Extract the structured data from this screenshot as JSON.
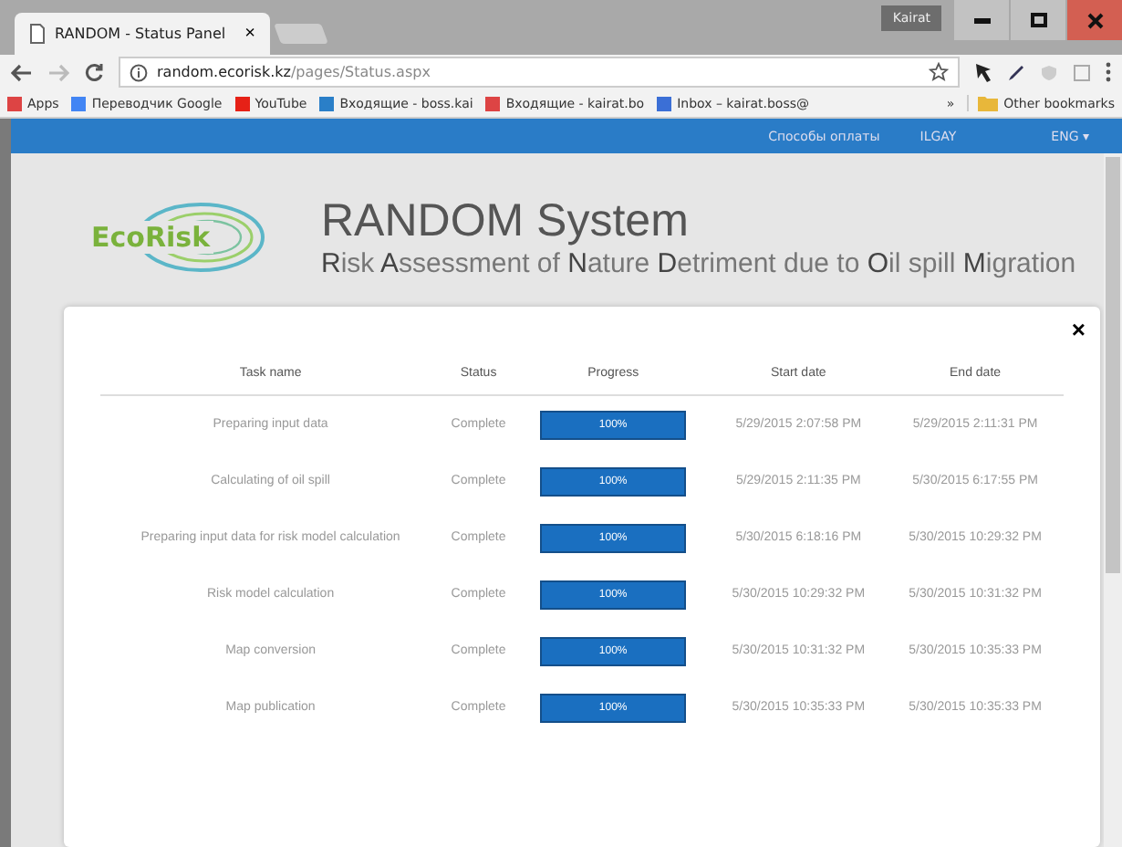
{
  "browser": {
    "tab_title": "RANDOM - Status Panel",
    "tab_close": "×",
    "profile": "Kairat",
    "url_host": "random.ecorisk.kz",
    "url_path": "/pages/Status.aspx",
    "bookmarks": [
      {
        "label": "Apps",
        "kind": "apps"
      },
      {
        "label": "Переводчик Google",
        "kind": "translate"
      },
      {
        "label": "YouTube",
        "kind": "youtube"
      },
      {
        "label": "Входящие - boss.kai",
        "kind": "inbox"
      },
      {
        "label": "Входящие - kairat.bo",
        "kind": "gmail"
      },
      {
        "label": "Inbox – kairat.boss@",
        "kind": "mail"
      }
    ],
    "more": "»",
    "other_bookmarks": "Other bookmarks"
  },
  "nav": {
    "links": [
      "Способы оплаты",
      "ILGAY"
    ],
    "language": "ENG ▾"
  },
  "header": {
    "logo": "EcoRisk",
    "title": "RANDOM System",
    "subtitle": "**R**isk **A**ssessment of **N**ature **D**etriment due to **O**il spill **M**igration"
  },
  "modal": {
    "close": "×",
    "table": {
      "columns": [
        "Task name",
        "Status",
        "Progress",
        "Start date",
        "End date"
      ],
      "rows": [
        {
          "task": "Preparing input data",
          "status": "Complete",
          "level": 1,
          "progress": "100%",
          "start": "5/29/2015 2:07:58 PM",
          "end": "5/29/2015 2:11:31 PM"
        },
        {
          "task": "Calculating of oil spill",
          "status": "Complete",
          "level": 1,
          "progress": "100%",
          "start": "5/29/2015 2:11:35 PM",
          "end": "5/30/2015 6:17:55 PM"
        },
        {
          "task": "Preparing input data for risk model calculation",
          "status": "Complete",
          "level": 1,
          "progress": "100%",
          "start": "5/30/2015 6:18:16 PM",
          "end": "5/30/2015 10:29:32 PM"
        },
        {
          "task": "Risk model calculation",
          "status": "Complete",
          "level": 1,
          "progress": "100%",
          "start": "5/30/2015 10:29:32 PM",
          "end": "5/30/2015 10:31:32 PM"
        },
        {
          "task": "Map conversion",
          "status": "Complete",
          "level": 1,
          "progress": "100%",
          "start": "5/30/2015 10:31:32 PM",
          "end": "5/30/2015 10:35:33 PM"
        },
        {
          "task": "Map publication",
          "status": "Complete",
          "level": 1,
          "progress": "100%",
          "start": "5/30/2015 10:35:33 PM",
          "end": "5/30/2015 10:35:33 PM"
        }
      ]
    }
  }
}
